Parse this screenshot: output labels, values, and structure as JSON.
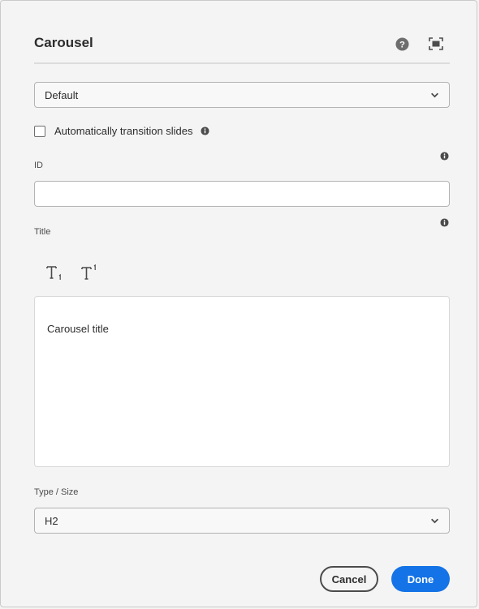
{
  "dialog": {
    "title": "Carousel",
    "help_icon": "help-circle-icon",
    "fullscreen_icon": "fullscreen-icon"
  },
  "variant_select": {
    "value": "Default"
  },
  "auto_transition": {
    "label": "Automatically transition slides",
    "checked": false
  },
  "id_field": {
    "label": "ID",
    "value": ""
  },
  "title_field": {
    "label": "Title",
    "toolbar": [
      "subscript-icon",
      "superscript-icon"
    ],
    "content": "Carousel title"
  },
  "type_size": {
    "label": "Type / Size",
    "value": "H2"
  },
  "footer": {
    "cancel_label": "Cancel",
    "done_label": "Done"
  },
  "colors": {
    "primary": "#1473e6",
    "background": "#f4f4f4"
  }
}
